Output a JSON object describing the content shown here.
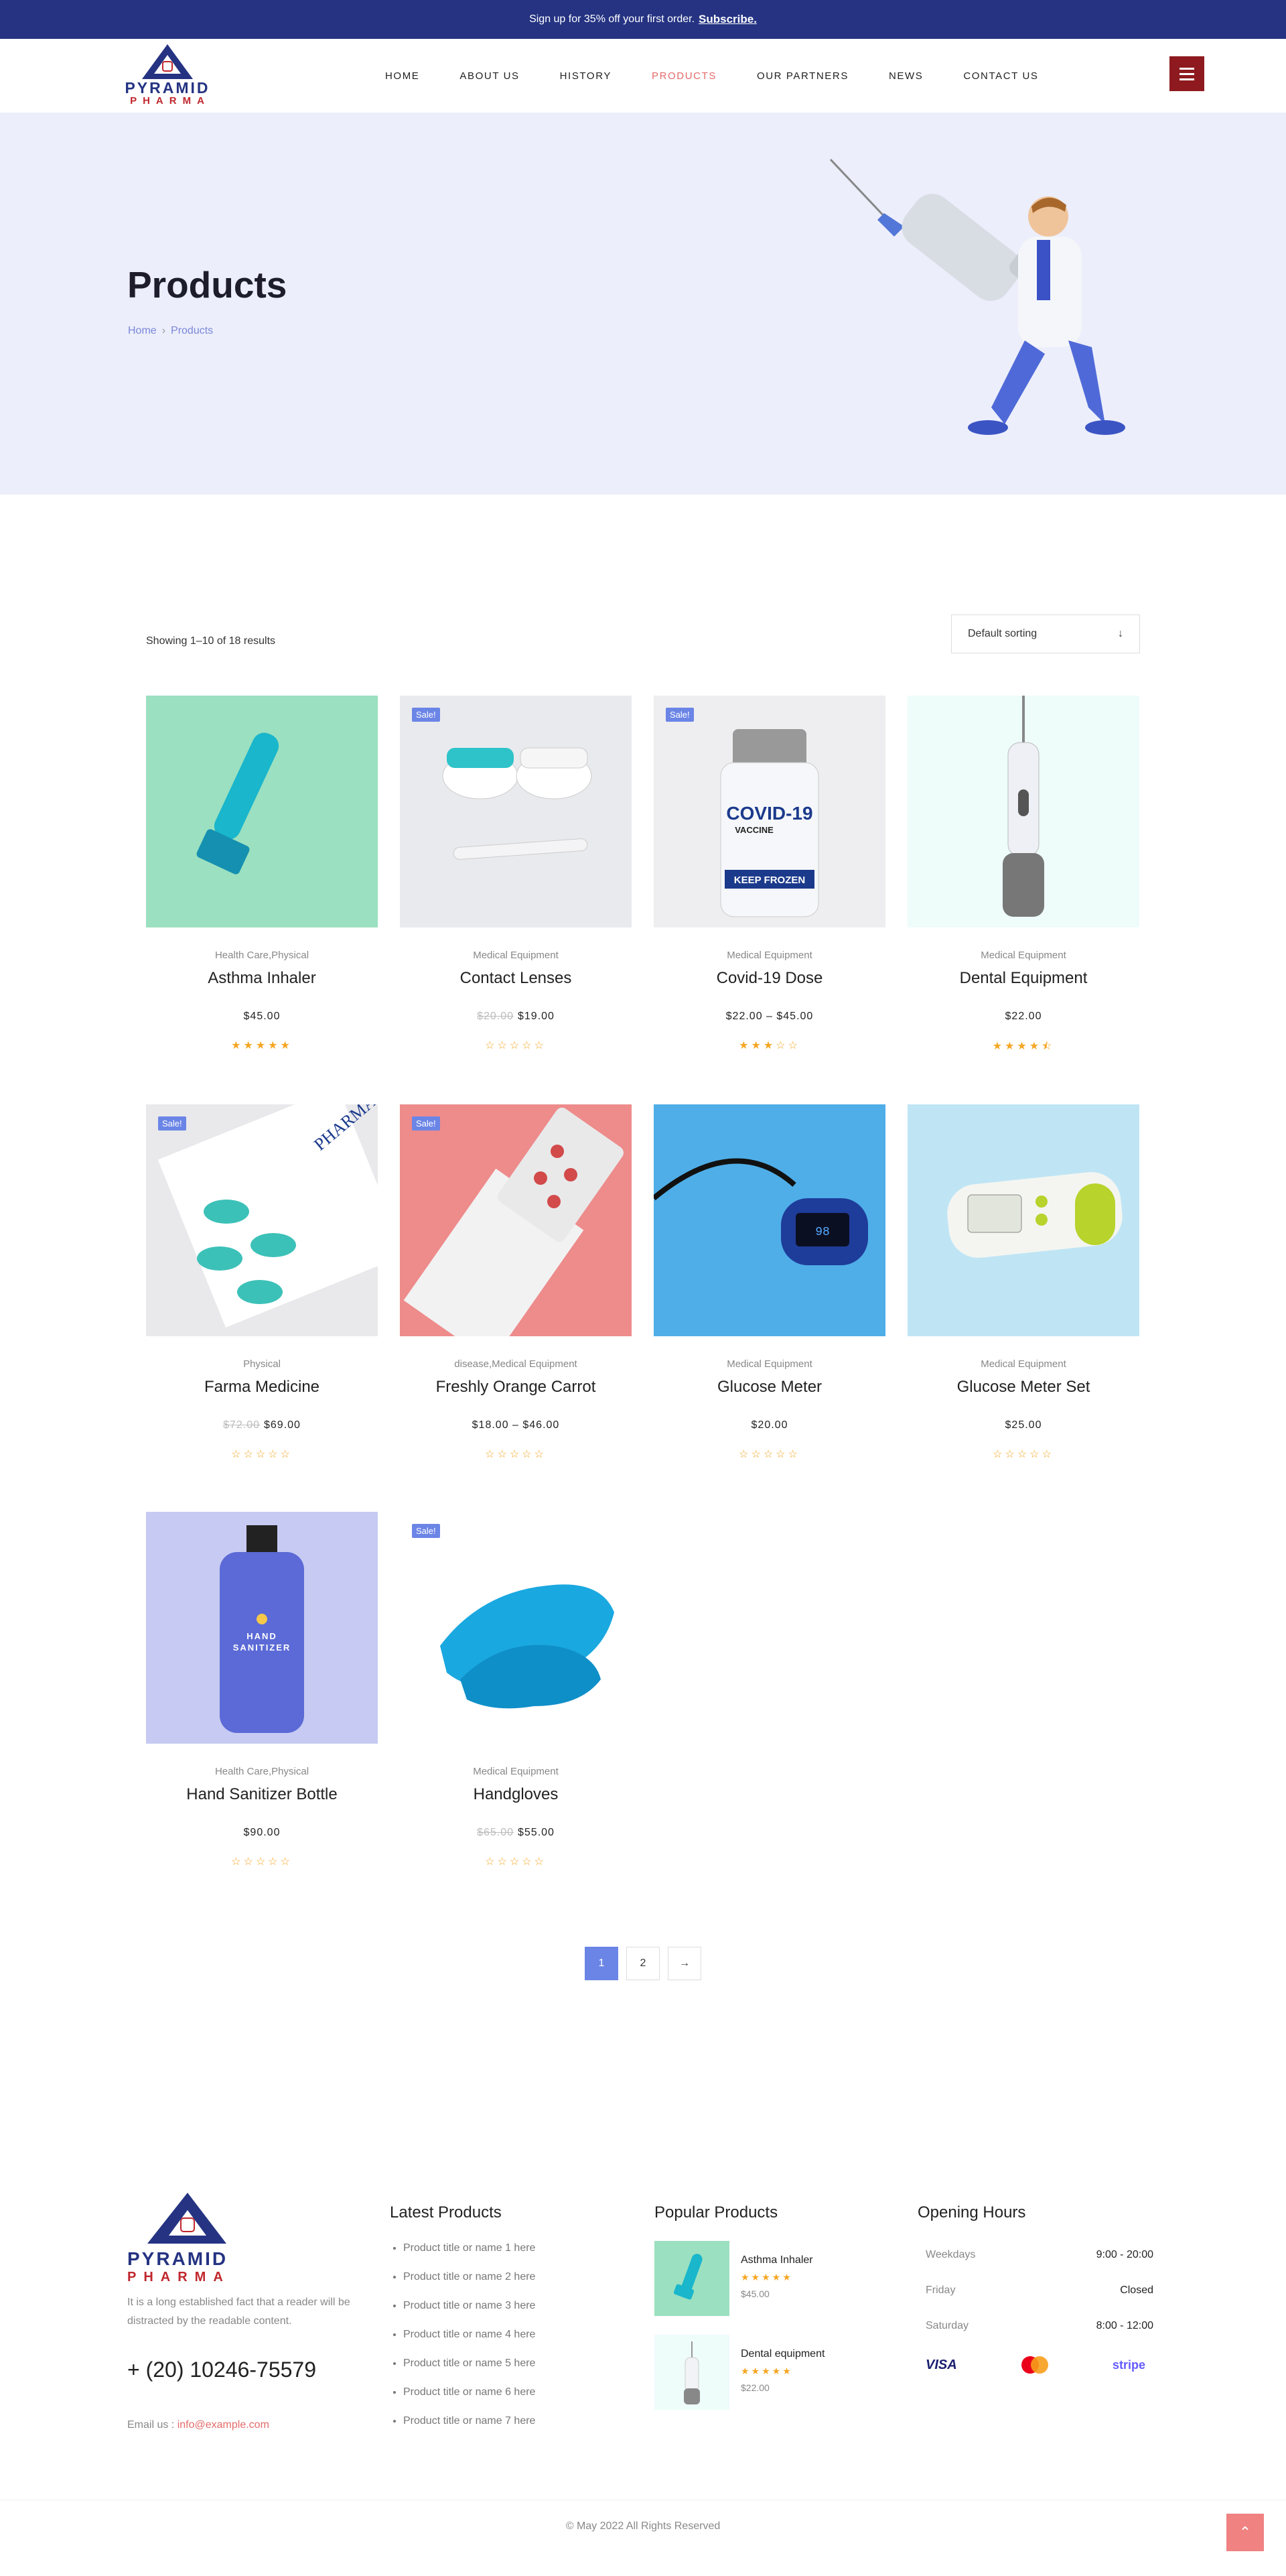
{
  "topbar": {
    "text": "Sign up for 35% off your first order.",
    "link": "Subscribe."
  },
  "logo": {
    "word1": "PYRAMID",
    "word2": "PHARMA"
  },
  "nav": [
    "HOME",
    "ABOUT US",
    "HISTORY",
    "PRODUCTS",
    "OUR PARTNERS",
    "NEWS",
    "CONTACT US"
  ],
  "nav_active": "PRODUCTS",
  "hero": {
    "title": "Products",
    "crumb_home": "Home",
    "crumb_current": "Products"
  },
  "shop": {
    "result_count": "Showing 1–10 of 18 results",
    "sort_label": "Default sorting",
    "sort_icon": "arrow-down-icon"
  },
  "sale_badge": "Sale!",
  "products": [
    {
      "cat": "Health Care,Physical",
      "title": "Asthma Inhaler",
      "price": "$45.00",
      "old": "",
      "sale": false,
      "rating": 5,
      "bg": "#9be0c0"
    },
    {
      "cat": "Medical Equipment",
      "title": "Contact Lenses",
      "price": "$19.00",
      "old": "$20.00",
      "sale": true,
      "rating": 0,
      "bg": "#e9eaee"
    },
    {
      "cat": "Medical Equipment",
      "title": "Covid-19 Dose",
      "price": "$22.00 – $45.00",
      "old": "",
      "sale": true,
      "rating": 3,
      "bg": "#eeeef0"
    },
    {
      "cat": "Medical Equipment",
      "title": "Dental Equipment",
      "price": "$22.00",
      "old": "",
      "sale": false,
      "rating": 4.5,
      "bg": "#eefcfa"
    },
    {
      "cat": "Physical",
      "title": "Farma Medicine",
      "price": "$69.00",
      "old": "$72.00",
      "sale": true,
      "rating": 0,
      "bg": "#e9e9ec"
    },
    {
      "cat": "disease,Medical Equipment",
      "title": "Freshly Orange Carrot",
      "price": "$18.00 – $46.00",
      "old": "",
      "sale": true,
      "rating": 0,
      "bg": "#ee8b8b"
    },
    {
      "cat": "Medical Equipment",
      "title": "Glucose Meter",
      "price": "$20.00",
      "old": "",
      "sale": false,
      "rating": 0,
      "bg": "#4faee8"
    },
    {
      "cat": "Medical Equipment",
      "title": "Glucose Meter Set",
      "price": "$25.00",
      "old": "",
      "sale": false,
      "rating": 0,
      "bg": "#bfe5f5"
    },
    {
      "cat": "Health Care,Physical",
      "title": "Hand Sanitizer Bottle",
      "price": "$90.00",
      "old": "",
      "sale": false,
      "rating": 0,
      "bg": "#c7caf2"
    },
    {
      "cat": "Medical Equipment",
      "title": "Handgloves",
      "price": "$55.00",
      "old": "$65.00",
      "sale": true,
      "rating": 0,
      "bg": "#ffffff"
    }
  ],
  "pagination": [
    "1",
    "2",
    "→"
  ],
  "footer": {
    "about": "It is a long established fact that a reader will be distracted by the readable content.",
    "phone": "+ (20) 10246-75579",
    "email_label": "Email us :",
    "email": "info@example.com",
    "latest_title": "Latest Products",
    "latest": [
      "Product title or name 1 here",
      "Product title or name 2 here",
      "Product title or name 3 here",
      "Product title or name 4 here",
      "Product title or name 5 here",
      "Product title or name 6 here",
      "Product title or name 7 here"
    ],
    "popular_title": "Popular Products",
    "popular": [
      {
        "name": "Asthma Inhaler",
        "price": "$45.00"
      },
      {
        "name": "Dental equipment",
        "price": "$22.00"
      }
    ],
    "hours_title": "Opening Hours",
    "hours": [
      {
        "day": "Weekdays",
        "time": "9:00 - 20:00"
      },
      {
        "day": "Friday",
        "time": "Closed"
      },
      {
        "day": "Saturday",
        "time": "8:00 - 12:00"
      }
    ],
    "payments": [
      "VISA",
      "stripe"
    ],
    "copyright": "© May 2022 All Rights Reserved"
  }
}
